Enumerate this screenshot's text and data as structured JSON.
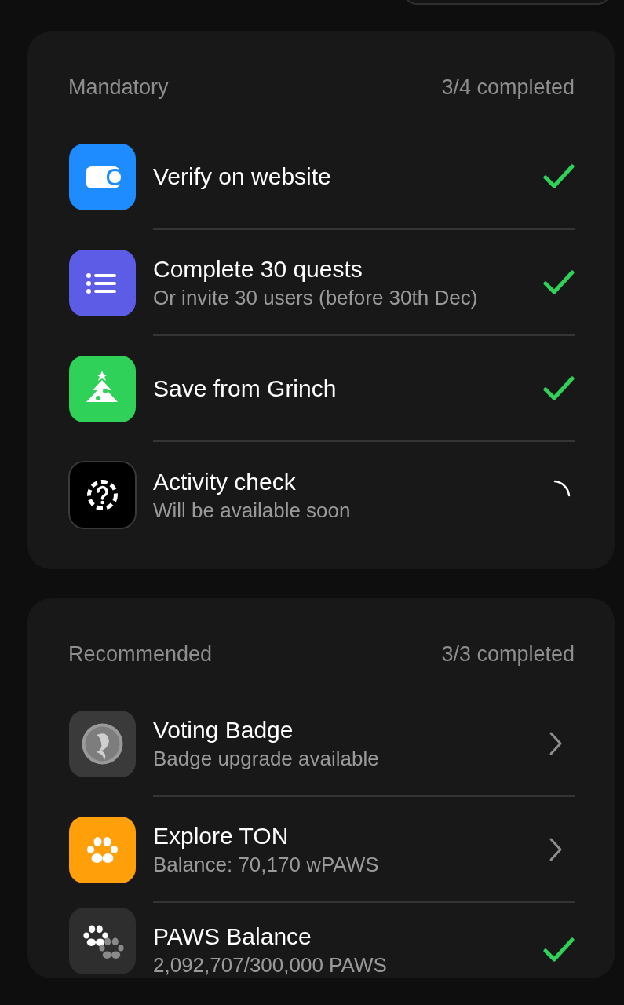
{
  "sections": [
    {
      "title": "Mandatory",
      "progress": "3/4 completed",
      "tasks": [
        {
          "title": "Verify on website",
          "kind": "done"
        },
        {
          "title": "Complete 30 quests",
          "subtitle": "Or invite 30 users (before 30th Dec)",
          "kind": "done"
        },
        {
          "title": "Save from Grinch",
          "kind": "done"
        },
        {
          "title": "Activity check",
          "subtitle": "Will be available soon",
          "kind": "pending"
        }
      ]
    },
    {
      "title": "Recommended",
      "progress": "3/3 completed",
      "tasks": [
        {
          "title": "Voting Badge",
          "subtitle": "Badge upgrade available",
          "kind": "link"
        },
        {
          "title": "Explore TON",
          "subtitle": "Balance: 70,170 wPAWS",
          "kind": "link"
        },
        {
          "title": "PAWS Balance",
          "subtitle": "2,092,707/300,000 PAWS",
          "kind": "done"
        }
      ]
    }
  ]
}
